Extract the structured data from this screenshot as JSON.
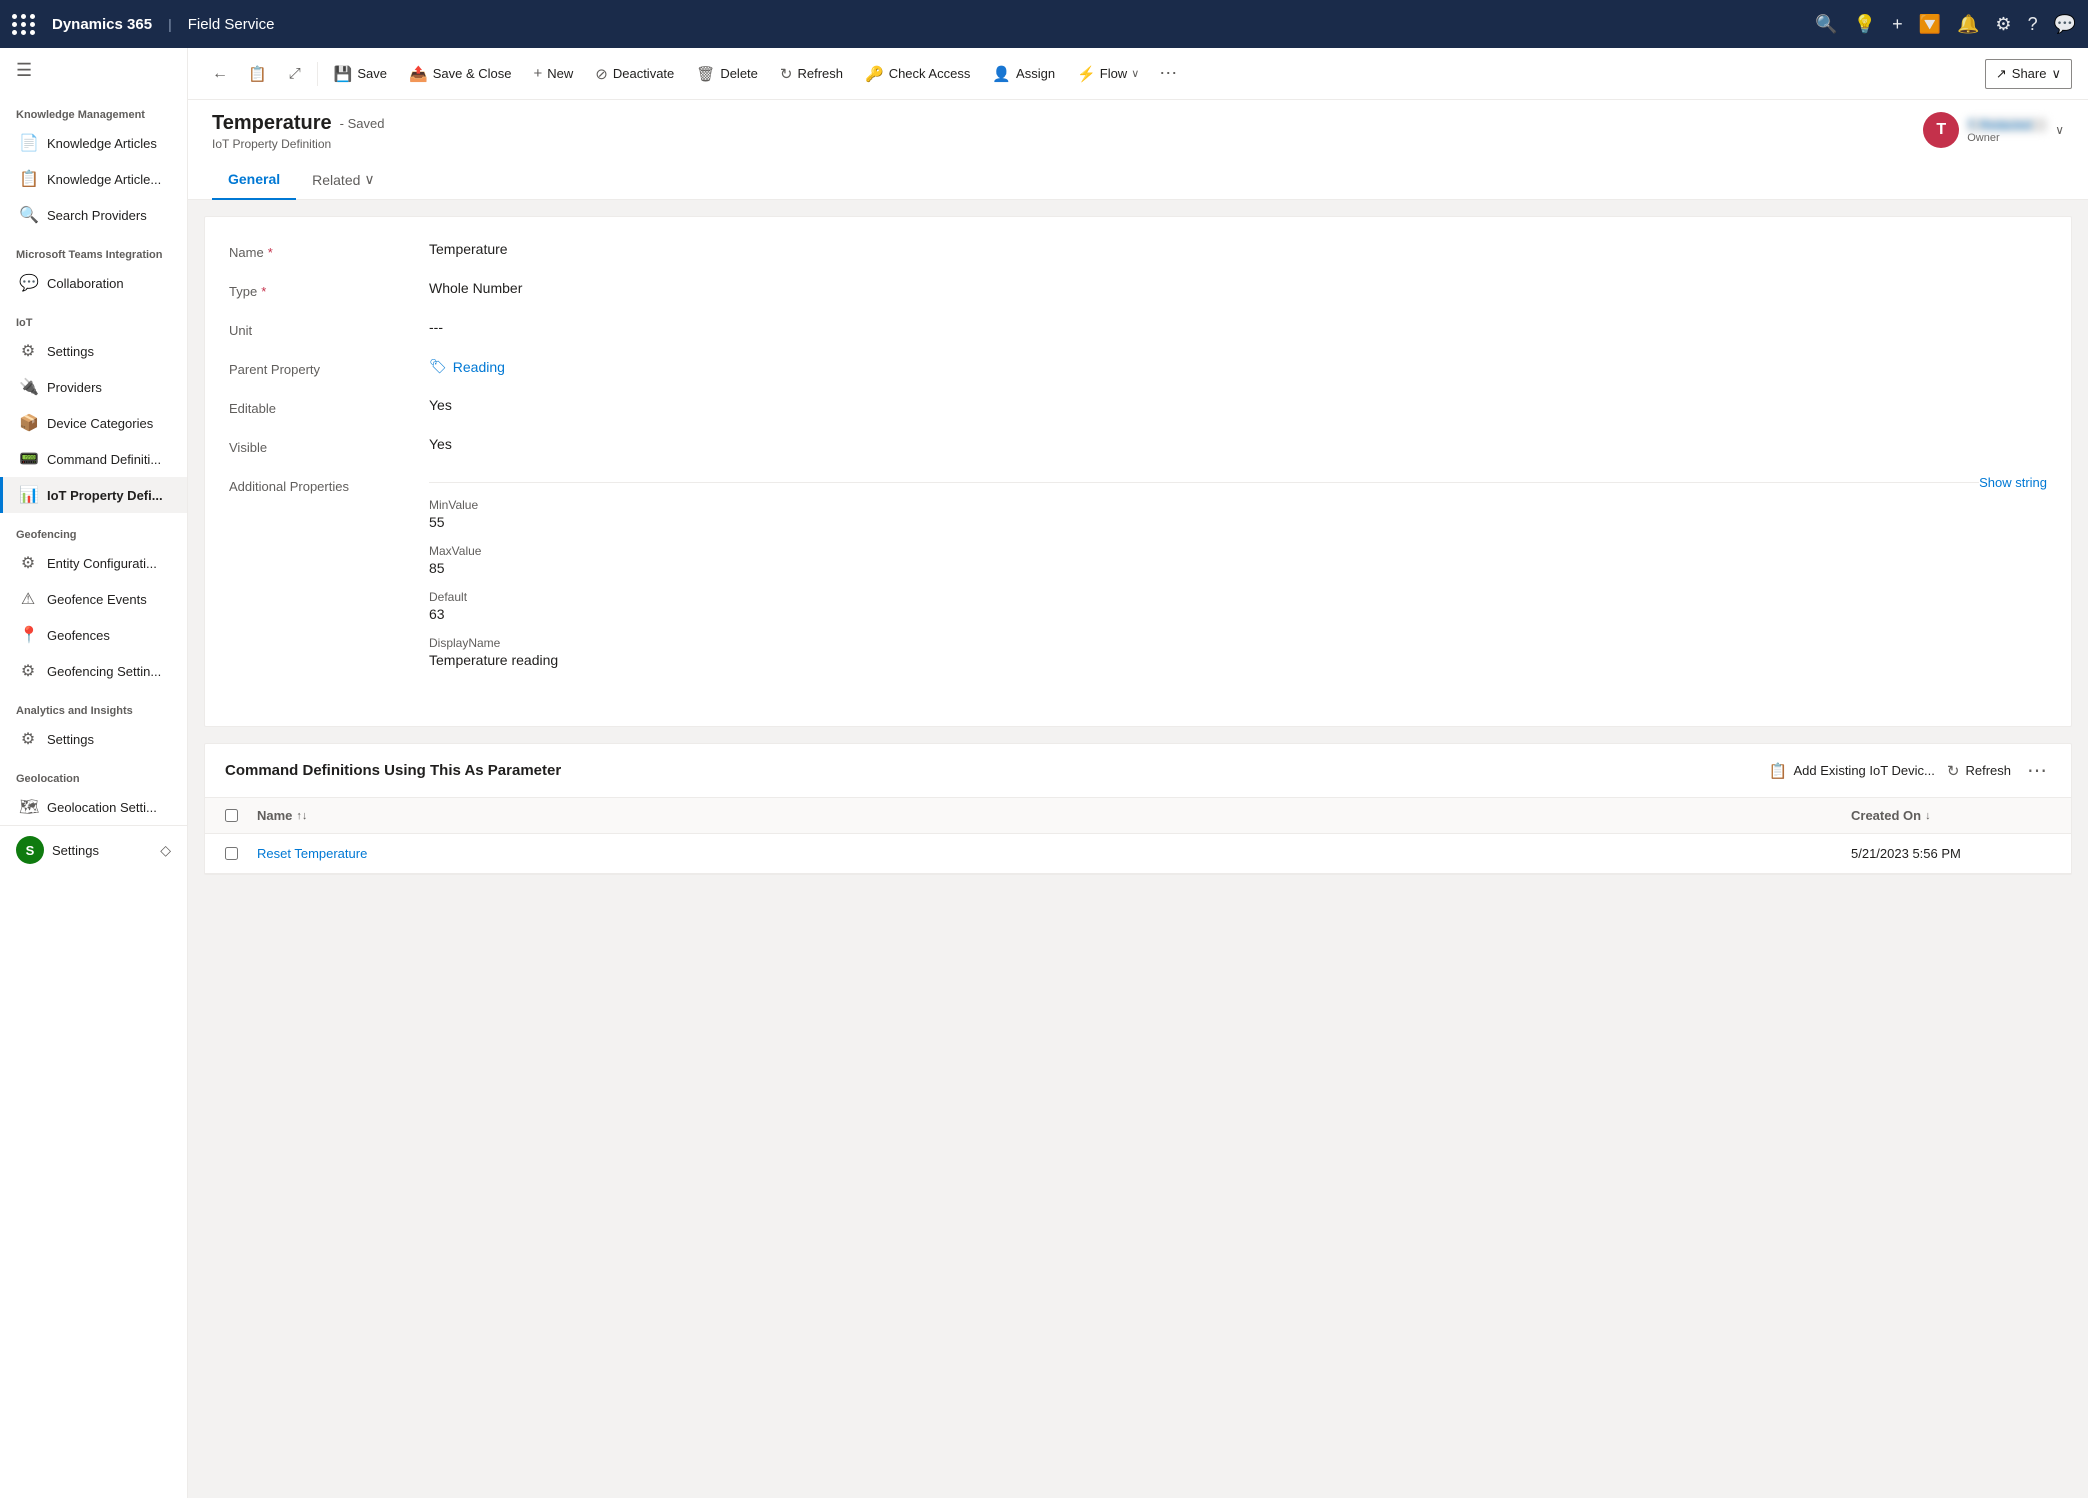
{
  "app": {
    "name": "Dynamics 365",
    "module": "Field Service"
  },
  "topnav": {
    "icons": [
      "search",
      "lightbulb",
      "plus",
      "filter",
      "bell",
      "gear",
      "help",
      "chat"
    ]
  },
  "sidebar": {
    "hamburger": "☰",
    "sections": [
      {
        "title": "Knowledge Management",
        "items": [
          {
            "id": "knowledge-articles",
            "label": "Knowledge Articles",
            "icon": "📄"
          },
          {
            "id": "knowledge-articles-2",
            "label": "Knowledge Article...",
            "icon": "📋"
          },
          {
            "id": "search-providers",
            "label": "Search Providers",
            "icon": "🔍"
          }
        ]
      },
      {
        "title": "Microsoft Teams Integration",
        "items": [
          {
            "id": "collaboration",
            "label": "Collaboration",
            "icon": "💬"
          }
        ]
      },
      {
        "title": "IoT",
        "items": [
          {
            "id": "settings",
            "label": "Settings",
            "icon": "⚙"
          },
          {
            "id": "providers",
            "label": "Providers",
            "icon": "🔌"
          },
          {
            "id": "device-categories",
            "label": "Device Categories",
            "icon": "📦"
          },
          {
            "id": "command-definitions",
            "label": "Command Definiti...",
            "icon": "📟"
          },
          {
            "id": "iot-property-definitions",
            "label": "IoT Property Defi...",
            "icon": "📊",
            "active": true
          }
        ]
      },
      {
        "title": "Geofencing",
        "items": [
          {
            "id": "entity-configuration",
            "label": "Entity Configurati...",
            "icon": "⚙"
          },
          {
            "id": "geofence-events",
            "label": "Geofence Events",
            "icon": "⚠"
          },
          {
            "id": "geofences",
            "label": "Geofences",
            "icon": "📍"
          },
          {
            "id": "geofencing-settings",
            "label": "Geofencing Settin...",
            "icon": "⚙"
          }
        ]
      },
      {
        "title": "Analytics and Insights",
        "items": [
          {
            "id": "analytics-settings",
            "label": "Settings",
            "icon": "⚙"
          }
        ]
      },
      {
        "title": "Geolocation",
        "items": [
          {
            "id": "geolocation-settings",
            "label": "Geolocation Setti...",
            "icon": "🗺"
          }
        ]
      }
    ],
    "bottom_item": {
      "label": "Settings",
      "icon": "S",
      "chevron": "◇"
    }
  },
  "toolbar": {
    "back_label": "←",
    "record_icon": "📋",
    "expand_icon": "⤢",
    "save_label": "Save",
    "save_close_label": "Save & Close",
    "new_label": "New",
    "deactivate_label": "Deactivate",
    "delete_label": "Delete",
    "refresh_label": "Refresh",
    "check_access_label": "Check Access",
    "assign_label": "Assign",
    "flow_label": "Flow",
    "more_label": "...",
    "share_label": "Share",
    "share_chevron": "∨"
  },
  "record": {
    "title": "Temperature",
    "saved_label": "- Saved",
    "subtitle": "IoT Property Definition",
    "owner_initial": "T",
    "owner_name": "T. [redacted]",
    "owner_label": "Owner",
    "chevron": "∨",
    "tabs": [
      {
        "id": "general",
        "label": "General",
        "active": true
      },
      {
        "id": "related",
        "label": "Related",
        "has_chevron": true
      }
    ]
  },
  "form": {
    "fields": [
      {
        "id": "name",
        "label": "Name",
        "required": true,
        "value": "Temperature",
        "type": "text"
      },
      {
        "id": "type",
        "label": "Type",
        "required": true,
        "value": "Whole Number",
        "type": "text"
      },
      {
        "id": "unit",
        "label": "Unit",
        "required": false,
        "value": "---",
        "type": "text"
      },
      {
        "id": "parent-property",
        "label": "Parent Property",
        "required": false,
        "value": "Reading",
        "type": "link",
        "icon": "🏷"
      },
      {
        "id": "editable",
        "label": "Editable",
        "required": false,
        "value": "Yes",
        "type": "text"
      },
      {
        "id": "visible",
        "label": "Visible",
        "required": false,
        "value": "Yes",
        "type": "text"
      }
    ],
    "additional_properties": {
      "label": "Additional Properties",
      "show_string_label": "Show string",
      "sub_fields": [
        {
          "id": "min-value",
          "label": "MinValue",
          "value": "55"
        },
        {
          "id": "max-value",
          "label": "MaxValue",
          "value": "85"
        },
        {
          "id": "default",
          "label": "Default",
          "value": "63"
        },
        {
          "id": "display-name",
          "label": "DisplayName",
          "value": "Temperature reading"
        }
      ]
    }
  },
  "command_definitions": {
    "title": "Command Definitions Using This As Parameter",
    "add_existing_label": "Add Existing IoT Devic...",
    "refresh_label": "Refresh",
    "columns": [
      {
        "id": "name",
        "label": "Name",
        "sort": "asc"
      },
      {
        "id": "created-on",
        "label": "Created On",
        "sort": "desc"
      }
    ],
    "rows": [
      {
        "id": "reset-temperature",
        "name": "Reset Temperature",
        "created_on": "5/21/2023 5:56 PM"
      }
    ]
  }
}
